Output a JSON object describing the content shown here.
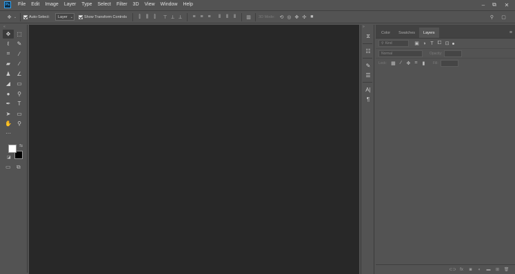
{
  "app": {
    "logo": "Ps"
  },
  "menu": [
    "File",
    "Edit",
    "Image",
    "Layer",
    "Type",
    "Select",
    "Filter",
    "3D",
    "View",
    "Window",
    "Help"
  ],
  "window_controls": {
    "minimize": "–",
    "restore": "⧉",
    "close": "✕"
  },
  "options_bar": {
    "auto_select_label": "Auto-Select:",
    "auto_select_target": "Layer",
    "auto_select_checked": true,
    "show_transform_label": "Show Transform Controls",
    "show_transform_checked": true,
    "mode_3d_label": "3D Mode:"
  },
  "toolbar": {
    "tools": [
      [
        "move-tool",
        "rect-marquee-tool"
      ],
      [
        "lasso-tool",
        "quick-select-tool"
      ],
      [
        "crop-tool",
        "eyedropper-tool"
      ],
      [
        "healing-brush-tool",
        "brush-tool"
      ],
      [
        "clone-stamp-tool",
        "history-brush-tool"
      ],
      [
        "eraser-tool",
        "gradient-tool"
      ],
      [
        "blur-tool",
        "dodge-tool"
      ],
      [
        "pen-tool",
        "type-tool"
      ],
      [
        "path-select-tool",
        "rectangle-tool"
      ],
      [
        "hand-tool",
        "zoom-tool"
      ]
    ],
    "foreground_color": "#ffffff",
    "background_color": "#000000"
  },
  "panel": {
    "tabs": [
      "Color",
      "Swatches",
      "Layers"
    ],
    "active_tab": "Layers",
    "kind_placeholder": "Kind",
    "blend_mode": "Normal",
    "opacity_label": "Opacity:",
    "lock_label": "Lock:",
    "fill_label": "Fill:"
  },
  "colors": {
    "canvas": "#282828",
    "chrome": "#535353"
  }
}
